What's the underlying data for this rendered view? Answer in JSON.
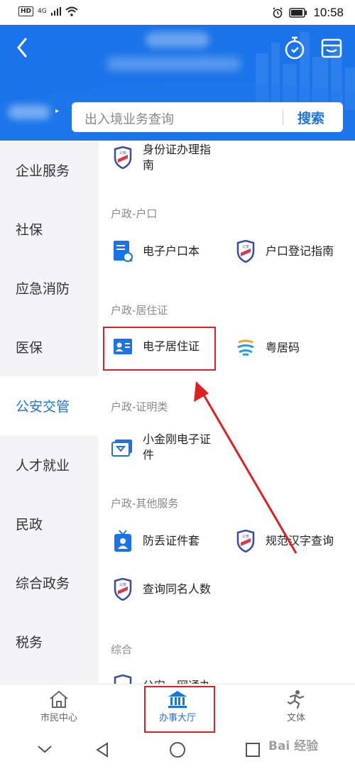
{
  "status": {
    "hd": "HD",
    "net": "4G",
    "time": "10:58"
  },
  "search": {
    "placeholder": "出入境业务查询",
    "button": "搜索"
  },
  "sidebar": {
    "items": [
      {
        "label": "企业服务"
      },
      {
        "label": "社保"
      },
      {
        "label": "应急消防"
      },
      {
        "label": "医保"
      },
      {
        "label": "公安交管",
        "active": true
      },
      {
        "label": "人才就业"
      },
      {
        "label": "民政"
      },
      {
        "label": "综合政务"
      },
      {
        "label": "税务"
      }
    ]
  },
  "content": {
    "top_item": {
      "line1": "身份证办理指",
      "line2": "南"
    },
    "sections": [
      {
        "title": "户政-户口",
        "items": [
          {
            "label": "电子户口本",
            "icon": "household-book-icon"
          },
          {
            "label": "户口登记指南",
            "icon": "police-badge-icon"
          }
        ]
      },
      {
        "title": "户政-居住证",
        "items": [
          {
            "label": "电子居住证",
            "icon": "id-card-icon"
          },
          {
            "label": "粤居码",
            "icon": "yue-logo-icon"
          }
        ]
      },
      {
        "title": "户政-证明类",
        "items": [
          {
            "line1": "小金刚电子证",
            "line2": "件",
            "icon": "certificate-icon"
          }
        ]
      },
      {
        "title": "户政-其他服务",
        "items": [
          {
            "label": "防丢证件套",
            "icon": "badge-holder-icon"
          },
          {
            "label": "规范汉字查询",
            "icon": "police-badge-icon"
          },
          {
            "label": "查询同名人数",
            "icon": "police-badge-icon"
          }
        ]
      },
      {
        "title": "综合",
        "items": []
      }
    ],
    "cut_text": "公安一网通办"
  },
  "tabs": [
    {
      "label": "市民中心"
    },
    {
      "label": "办事大厅",
      "active": true
    },
    {
      "label": "文体"
    }
  ],
  "watermark": "Bai 经验",
  "colors": {
    "primary": "#1a73e8",
    "highlight": "#e02020"
  }
}
